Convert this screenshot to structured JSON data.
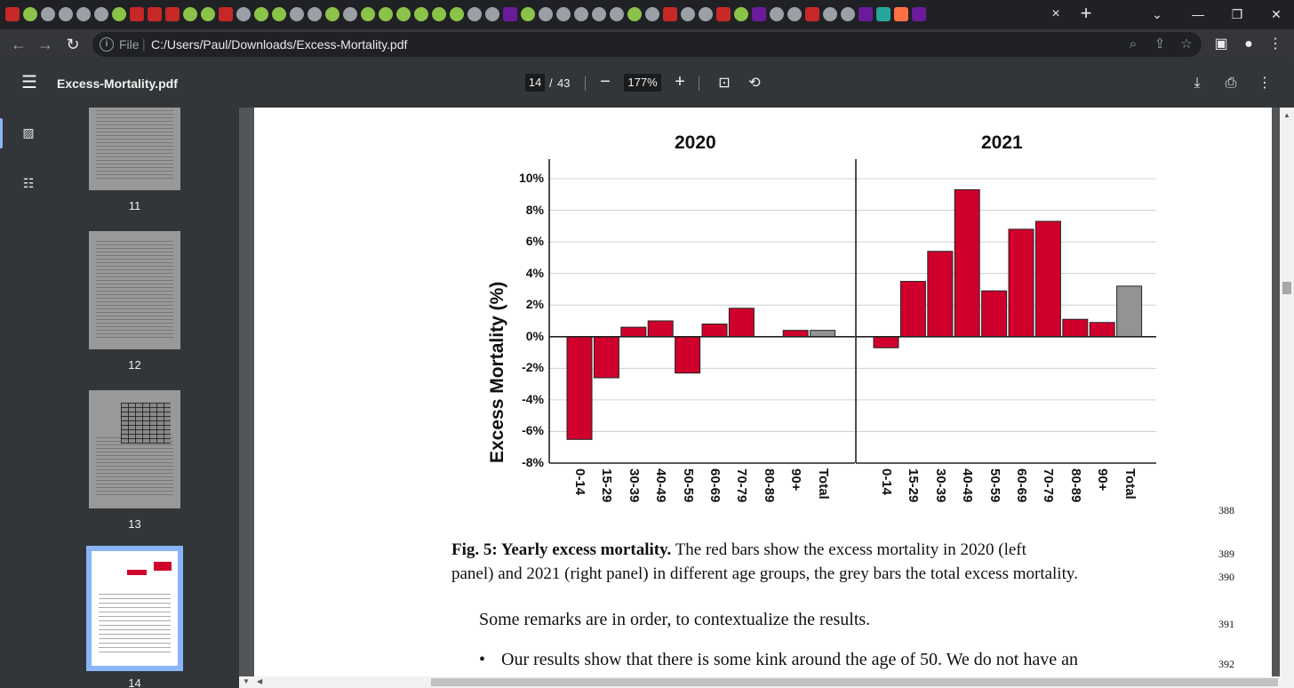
{
  "browser": {
    "favicon_strip": [
      "red",
      "green",
      "grey",
      "grey",
      "grey",
      "grey",
      "green",
      "red",
      "red",
      "red",
      "green",
      "green",
      "red",
      "grey",
      "green",
      "green",
      "grey",
      "grey",
      "green",
      "grey",
      "green",
      "green",
      "green",
      "green",
      "green",
      "green",
      "grey",
      "grey",
      "purple",
      "green",
      "grey",
      "grey",
      "grey",
      "grey",
      "grey",
      "green",
      "grey",
      "red",
      "grey",
      "grey",
      "red",
      "green",
      "purple",
      "grey",
      "grey",
      "red",
      "grey",
      "grey",
      "purple",
      "teal",
      "orange",
      "purple"
    ],
    "active_tab_close": "×",
    "new_tab": "+",
    "window_controls": {
      "list": "⌄",
      "minimize": "—",
      "restore": "❐",
      "close": "✕"
    },
    "nav": {
      "back": "←",
      "forward": "→",
      "reload": "↻"
    },
    "omnibox": {
      "scheme_label": "File",
      "separator": "|",
      "url": "C:/Users/Paul/Downloads/Excess-Mortality.pdf"
    },
    "omnibox_icons": [
      "zoom-icon",
      "share-icon",
      "star-icon"
    ],
    "toolbar_icons": [
      "side-panel-icon",
      "profile-icon",
      "browser-menu-icon"
    ]
  },
  "pdf_toolbar": {
    "title": "Excess-Mortality.pdf",
    "current_page": "14",
    "page_separator": "/",
    "total_pages": "43",
    "zoom_out": "−",
    "zoom": "177%",
    "zoom_in": "+"
  },
  "sidebar": {
    "thumbnails": [
      {
        "label": "11"
      },
      {
        "label": "12"
      },
      {
        "label": "13"
      },
      {
        "label": "14"
      }
    ]
  },
  "chart_data": {
    "type": "bar",
    "ylabel": "Excess Mortality (%)",
    "ylim": [
      -8,
      10
    ],
    "yticks": [
      "10%",
      "8%",
      "6%",
      "4%",
      "2%",
      "0%",
      "-2%",
      "-4%",
      "-6%",
      "-8%"
    ],
    "grid": true,
    "categories": [
      "0-14",
      "15-29",
      "30-39",
      "40-49",
      "50-59",
      "60-69",
      "70-79",
      "80-89",
      "90+",
      "Total"
    ],
    "panels": [
      {
        "title": "2020",
        "values": [
          -6.5,
          -2.6,
          0.6,
          1.0,
          -2.3,
          0.8,
          1.8,
          0.0,
          0.4,
          0.4
        ]
      },
      {
        "title": "2021",
        "values": [
          -0.7,
          3.5,
          5.4,
          9.3,
          2.9,
          6.8,
          7.3,
          1.1,
          0.9,
          3.2
        ]
      }
    ],
    "colors": {
      "age_group": "#d0002d",
      "total": "#939393"
    }
  },
  "document": {
    "caption_bold": "Fig. 5: Yearly excess mortality.",
    "caption_rest": " The red bars show the excess mortality in 2020 (left",
    "caption_line2": "panel) and 2021 (right panel) in different age groups, the grey bars the total excess mortality.",
    "paragraph": "Some remarks are in order, to contextualize the results.",
    "bullet_marker": "•",
    "bullet_text": "Our results show that there is some kink around the age of 50. We do not have an",
    "line_numbers": [
      "388",
      "389",
      "390",
      "391",
      "392"
    ]
  }
}
